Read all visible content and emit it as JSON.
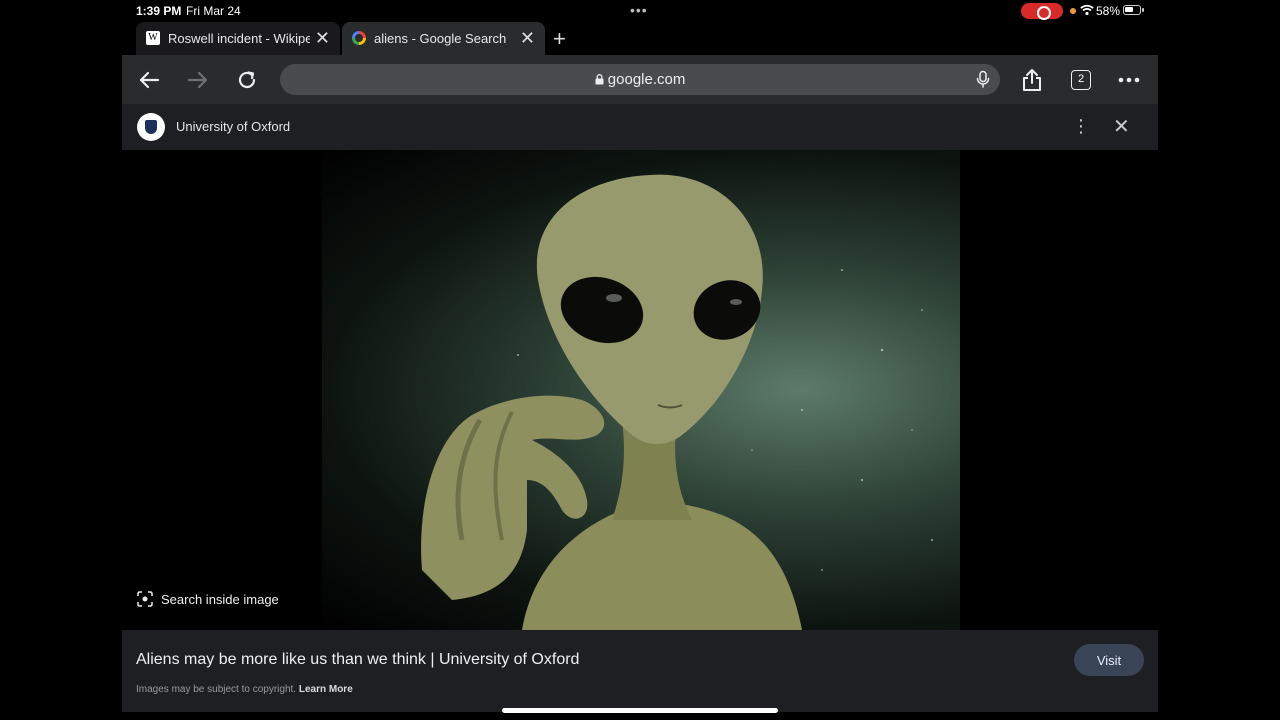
{
  "status": {
    "time": "1:39 PM",
    "date": "Fri Mar 24",
    "dots": "•••",
    "battery": "58%"
  },
  "tabs": [
    {
      "title": "Roswell incident - Wikipedia",
      "favicon": "W",
      "close": "✕"
    },
    {
      "title": "aliens - Google Search",
      "favicon": "google-g-icon",
      "close": "✕"
    }
  ],
  "new_tab": "+",
  "toolbar": {
    "url": "google.com",
    "tab_count": "2"
  },
  "site_panel": {
    "name": "University of Oxford",
    "kebab": "⋮",
    "close": "✕",
    "search_inside": "Search inside image",
    "result_title": "Aliens may be more like us than we think | University of Oxford",
    "copyright": "Images may be subject to copyright.",
    "learn_more": "Learn More",
    "visit": "Visit"
  },
  "colors": {
    "toolbar_bg": "#2a2b2d",
    "panel_bg": "#1d1f22",
    "visit_bg": "#394457",
    "record_red": "#d92a2a"
  }
}
